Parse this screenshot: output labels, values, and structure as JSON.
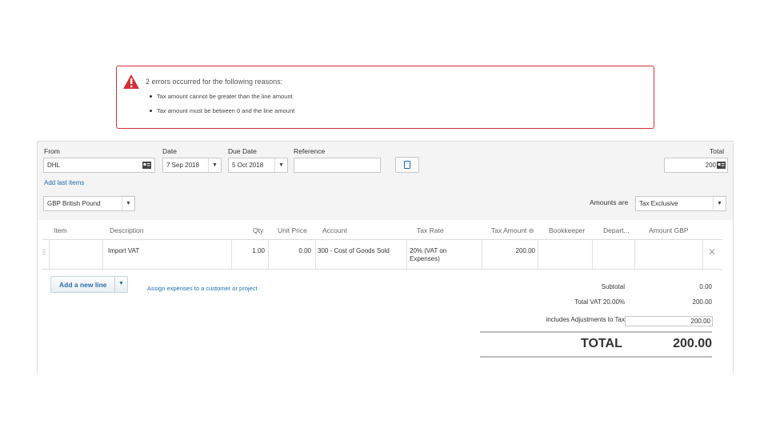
{
  "error": {
    "title": "2 errors occurred for the following reasons:",
    "items": [
      "Tax amount cannot be greater than the line amount",
      "Tax amount must be between 0 and the line amount"
    ]
  },
  "header": {
    "from_label": "From",
    "from_value": "DHL",
    "date_label": "Date",
    "date_value": "7 Sep 2018",
    "due_label": "Due Date",
    "due_value": "5 Oct 2018",
    "reference_label": "Reference",
    "reference_value": "",
    "total_label": "Total",
    "total_value": "200",
    "add_last_items": "Add last items",
    "currency_value": "GBP British Pound",
    "amounts_are_label": "Amounts are",
    "amounts_are_value": "Tax Exclusive"
  },
  "table": {
    "columns": [
      "Item",
      "Description",
      "Qty",
      "Unit Price",
      "Account",
      "Tax Rate",
      "Tax Amount",
      "Bookkeeper",
      "Depart...",
      "Amount GBP"
    ],
    "rows": [
      {
        "item": "",
        "description": "Import VAT",
        "qty": "1.00",
        "unit_price": "0.00",
        "account": "300 - Cost of Goods Sold",
        "tax_rate": "20% (VAT on Expenses)",
        "tax_amount": "200.00",
        "bookkeeper": "",
        "department": "",
        "amount": ""
      }
    ]
  },
  "actions": {
    "add_line_label": "Add a new line",
    "assign_link": "Assign expenses to a customer or project"
  },
  "totals": {
    "subtotal_label": "Subtotal",
    "subtotal_value": "0.00",
    "vat_label": "Total VAT 20.00%",
    "vat_value": "200.00",
    "adjust_label": "includes Adjustments to Tax",
    "adjust_value": "200.00",
    "total_label": "TOTAL",
    "total_value": "200.00"
  },
  "colors": {
    "error_border": "#d3303a",
    "link_blue": "#1f6eb4"
  },
  "icons": [
    "warning-icon",
    "contact-card-icon",
    "chevron-down-icon",
    "copy-icon",
    "sort-icon",
    "drag-handle-icon",
    "close-icon"
  ]
}
